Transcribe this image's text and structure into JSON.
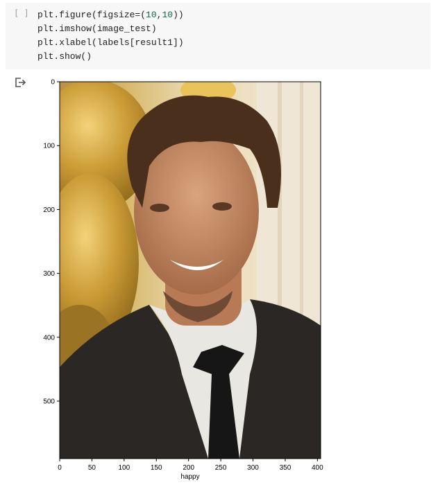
{
  "cell": {
    "bracket": "[ ]",
    "code_lines": [
      {
        "parts": [
          {
            "t": "plt.figure(figsize=("
          },
          {
            "t": "10",
            "c": "num"
          },
          {
            "t": ","
          },
          {
            "t": "10",
            "c": "num"
          },
          {
            "t": "))"
          }
        ]
      },
      {
        "parts": [
          {
            "t": "plt.imshow(image_test)"
          }
        ]
      },
      {
        "parts": [
          {
            "t": "plt.xlabel(labels[result1])"
          }
        ]
      },
      {
        "parts": [
          {
            "t": "plt.show()"
          }
        ]
      }
    ]
  },
  "output": {
    "icon": "output-arrow-icon",
    "image": "portrait of a smiling man in a dark suit and tie against a gold background"
  },
  "chart_data": {
    "type": "image",
    "xlabel": "happy",
    "xlim": [
      0,
      405
    ],
    "ylim": [
      590,
      0
    ],
    "xticks": [
      "0",
      "50",
      "100",
      "150",
      "200",
      "250",
      "300",
      "350",
      "400"
    ],
    "yticks": [
      "0",
      "100",
      "200",
      "300",
      "400",
      "500"
    ]
  }
}
